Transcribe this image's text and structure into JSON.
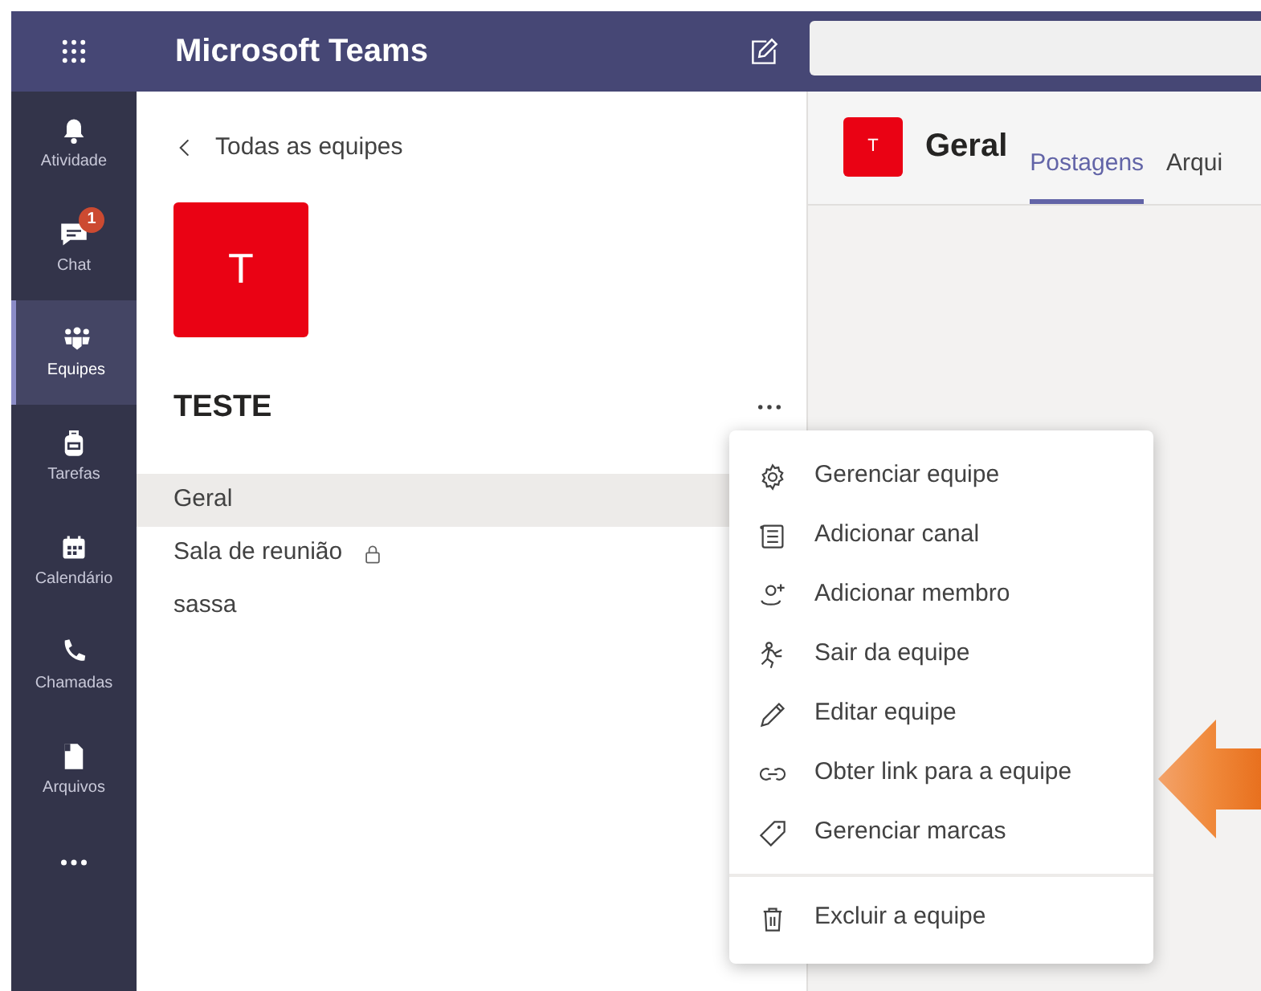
{
  "app": {
    "title": "Microsoft Teams"
  },
  "rail": [
    {
      "label": "Atividade",
      "selected": false
    },
    {
      "label": "Chat",
      "selected": false,
      "badge": "1"
    },
    {
      "label": "Equipes",
      "selected": true
    },
    {
      "label": "Tarefas",
      "selected": false
    },
    {
      "label": "Calendário",
      "selected": false
    },
    {
      "label": "Chamadas",
      "selected": false
    },
    {
      "label": "Arquivos",
      "selected": false
    }
  ],
  "team_panel": {
    "back_link": "Todas as equipes",
    "avatar": "T",
    "team_name": "TESTE",
    "channels": [
      {
        "name": "Geral",
        "selected": true,
        "locked": false
      },
      {
        "name": "Sala de reunião",
        "selected": false,
        "locked": true
      },
      {
        "name": "sassa",
        "selected": false,
        "locked": false
      }
    ]
  },
  "channel_header": {
    "avatar": "T",
    "title": "Geral",
    "tabs": [
      {
        "label": "Postagens",
        "selected": true
      },
      {
        "label": "Arqui",
        "selected": false
      }
    ]
  },
  "menu": {
    "groups": [
      [
        {
          "label": "Gerenciar equipe"
        },
        {
          "label": "Adicionar canal"
        },
        {
          "label": "Adicionar membro"
        },
        {
          "label": "Sair da equipe"
        },
        {
          "label": "Editar equipe"
        },
        {
          "label": "Obter link para a equipe"
        },
        {
          "label": "Gerenciar marcas"
        }
      ],
      [
        {
          "label": "Excluir a equipe"
        }
      ]
    ]
  }
}
